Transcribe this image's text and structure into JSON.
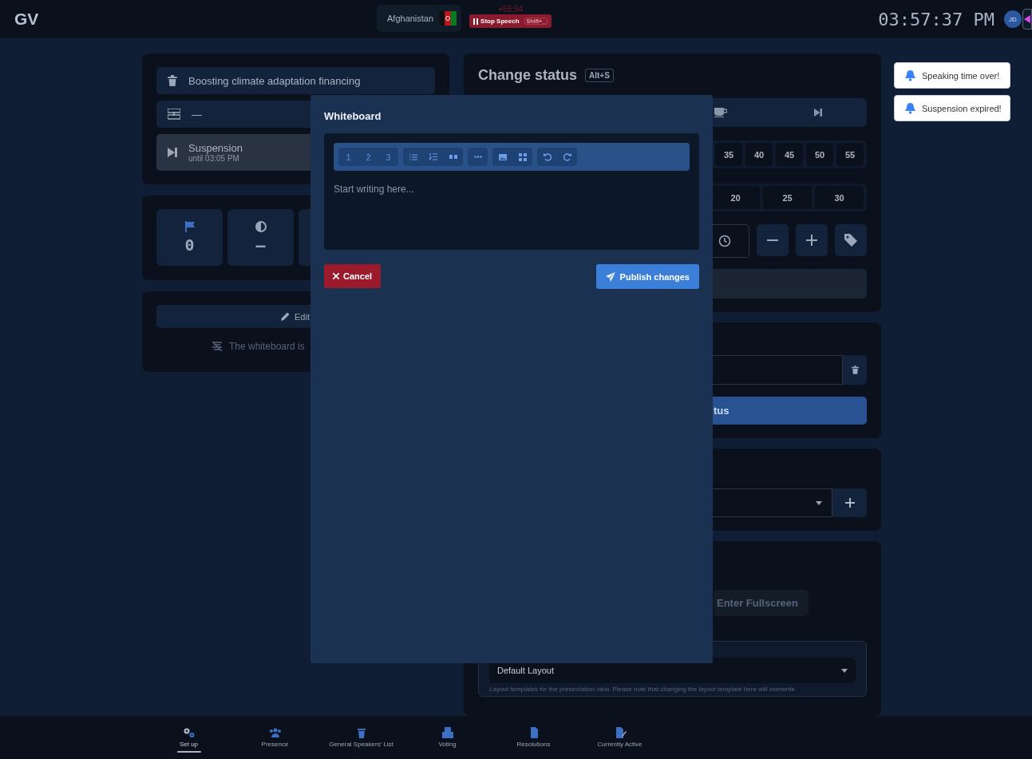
{
  "top_bar": {
    "logo": "GV",
    "country": "Afghanistan",
    "timer": "+58:54",
    "stop_button": {
      "label": "Stop Speech",
      "shortcut": "Shift+_"
    },
    "clock": "03:57:37 PM",
    "avatar": "JD"
  },
  "agenda": {
    "topic": "Boosting climate adaptation financing",
    "row_2": "—",
    "status": {
      "label": "Suspension",
      "until": "until 03:05 PM"
    }
  },
  "stats": [
    {
      "kind": "flag",
      "value": "0"
    },
    {
      "kind": "contrast",
      "value": "—"
    }
  ],
  "whiteboard_card": {
    "edit_button": "Edit",
    "empty_note": "The whiteboard is"
  },
  "status_panel": {
    "title": "Change status",
    "shortcut": "Alt+S",
    "minutes_row_1": [
      "35",
      "40",
      "45",
      "50",
      "55"
    ],
    "minutes_row_2": [
      "20",
      "25",
      "30"
    ],
    "submit_button": "tus"
  },
  "presentation": {
    "fullscreen_button": "Enter Fullscreen",
    "layout_select": "Default Layout",
    "layout_help": "Layout templates for the presentation view. Please note that changing the layout template here will overwrite"
  },
  "toasts": [
    "Speaking time over!",
    "Suspension expired!"
  ],
  "modal": {
    "title": "Whiteboard",
    "heading_buttons": [
      "1",
      "2",
      "3"
    ],
    "placeholder": "Start writing here...",
    "cancel": "Cancel",
    "publish": "Publish changes"
  },
  "nav": [
    {
      "kind": "setup",
      "label": "Set up",
      "selected": true
    },
    {
      "kind": "presence",
      "label": "Presence",
      "selected": false
    },
    {
      "kind": "speakers",
      "label": "General Speakers' List",
      "selected": false
    },
    {
      "kind": "voting",
      "label": "Voting",
      "selected": false
    },
    {
      "kind": "resolutions",
      "label": "Resolutions",
      "selected": false
    },
    {
      "kind": "active",
      "label": "Currently Active",
      "selected": false
    }
  ]
}
